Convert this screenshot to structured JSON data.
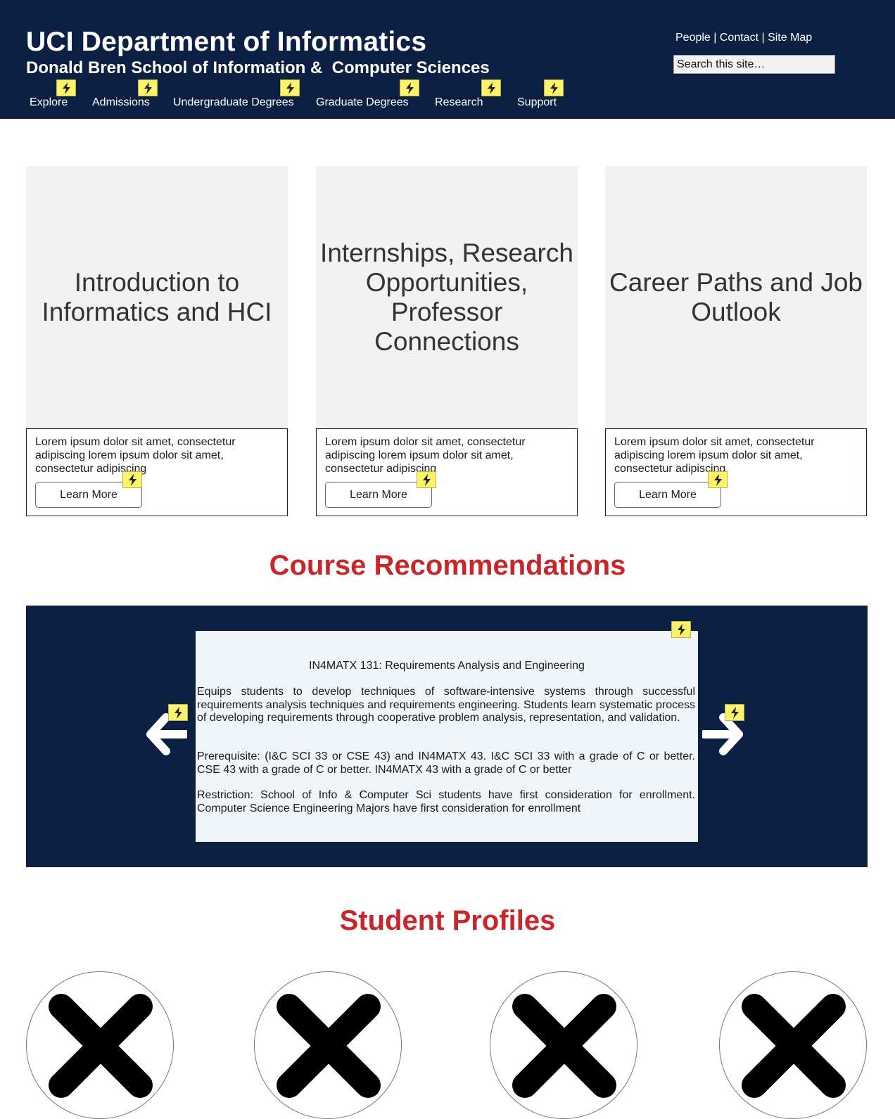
{
  "header": {
    "title": "UCI Department of Informatics",
    "subtitle": "Donald Bren School of Information &  Computer Sciences",
    "util_links": {
      "people": "People",
      "contact": "Contact",
      "sitemap": "Site Map",
      "separator": " | "
    },
    "search": {
      "placeholder": "Search this site…"
    },
    "nav": [
      {
        "label": "Explore"
      },
      {
        "label": "Admissions"
      },
      {
        "label": "Undergraduate Degrees"
      },
      {
        "label": "Graduate Degrees"
      },
      {
        "label": "Research"
      },
      {
        "label": "Support"
      }
    ]
  },
  "cards": [
    {
      "title": "Introduction to Informatics and HCI",
      "text": "Lorem ipsum dolor sit amet, consectetur adipiscing lorem ipsum dolor sit amet, consectetur adipiscing",
      "button": "Learn More"
    },
    {
      "title": "Internships, Research Opportunities, Professor Connections",
      "text": "Lorem ipsum dolor sit amet, consectetur adipiscing lorem ipsum dolor sit amet, consectetur adipiscing",
      "button": "Learn More"
    },
    {
      "title": "Career Paths and Job Outlook",
      "text": "Lorem ipsum dolor sit amet, consectetur adipiscing lorem ipsum dolor sit amet, consectetur adipiscing",
      "button": "Learn More"
    }
  ],
  "courses": {
    "heading": "Course Recommendations",
    "current": {
      "title": "IN4MATX 131: Requirements Analysis and Engineering",
      "description": "Equips students to develop techniques of software-intensive systems through successful requirements analysis techniques and requirements engineering. Students learn systematic process of developing requirements through cooperative problem analysis, representation, and validation.",
      "prerequisite": "Prerequisite: (I&C SCI 33 or CSE 43) and IN4MATX 43. I&C SCI 33 with a grade of C or better. CSE 43 with a grade of C or better. IN4MATX 43 with a grade of C or better",
      "restriction": "Restriction: School of Info & Computer Sci students have first consideration for enrollment. Computer Science Engineering Majors have first consideration for enrollment"
    }
  },
  "profiles": {
    "heading": "Student Profiles",
    "count": 4,
    "placeholder_icon": "x-placeholder-icon"
  },
  "icons": {
    "marker": "lightning-icon",
    "prev": "arrow-left-icon",
    "next": "arrow-right-icon"
  },
  "colors": {
    "navy": "#0b2042",
    "heading_red": "#c8262a",
    "marker_yellow": "#fdf36b",
    "card_gray": "#f2f2f2"
  }
}
